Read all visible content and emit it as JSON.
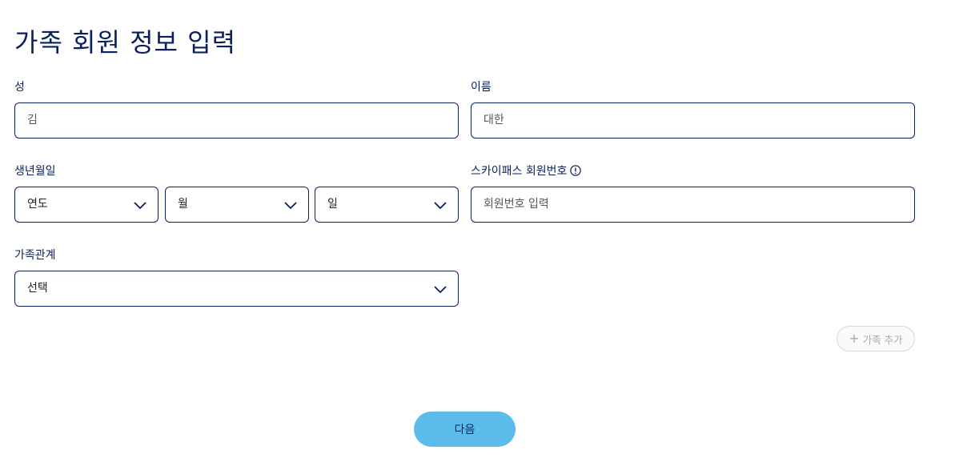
{
  "page": {
    "title": "가족 회원 정보 입력"
  },
  "form": {
    "last_name": {
      "label": "성",
      "value": "김"
    },
    "first_name": {
      "label": "이름",
      "value": "대한"
    },
    "birth": {
      "label": "생년월일",
      "year": "연도",
      "month": "월",
      "day": "일"
    },
    "skypass": {
      "label": "스카이패스 회원번호",
      "placeholder": "회원번호 입력"
    },
    "relation": {
      "label": "가족관계",
      "value": "선택"
    }
  },
  "actions": {
    "add_family": "가족 추가",
    "next": "다음"
  },
  "colors": {
    "primary_navy": "#0b1f5c",
    "next_button": "#5bbcec",
    "disabled_gray": "#aaaaaa"
  },
  "icons": {
    "select": "chevron-down-icon",
    "info": "info-icon",
    "add": "plus-icon"
  }
}
